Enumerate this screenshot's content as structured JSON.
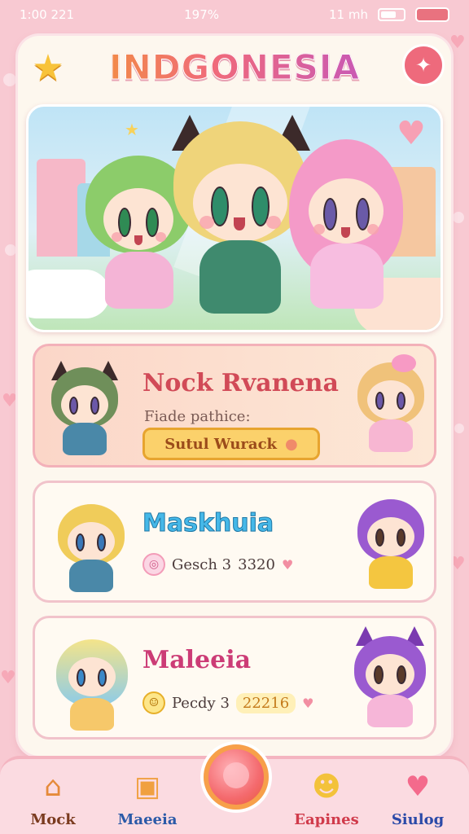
{
  "status_bar": {
    "time": "1:00 221",
    "center": "197%",
    "signal": "11 mh"
  },
  "header": {
    "title": "INDGONESIA",
    "left_icon": "star-icon",
    "right_icon": "candy-icon"
  },
  "hero": {
    "characters": [
      "green-hair-cat-girl",
      "blonde-cat-girl",
      "pink-hair-girl"
    ]
  },
  "cards": [
    {
      "title": "Nock Rvanena",
      "subtitle": "Fiade pathice:",
      "button_label": "Sutul Wurack",
      "button_icon": "bean-icon"
    },
    {
      "title": "Maskhuia",
      "stat_text": "Gesch 3",
      "stat_value": "3320",
      "stat_icon": "coin-icon"
    },
    {
      "title": "Maleeia",
      "stat_text": "Pecdy 3",
      "stat_value": "22216",
      "stat_icon": "smile-coin-icon"
    }
  ],
  "tab_bar": {
    "tabs": [
      {
        "label": "Mock",
        "icon": "house-icon",
        "color": "#7a3b1f"
      },
      {
        "label": "Maeeia",
        "icon": "gift-box-icon",
        "color": "#2b5aa8"
      },
      {
        "label": "",
        "icon": "center-orb-icon",
        "color": "#f46a6e"
      },
      {
        "label": "Eapines",
        "icon": "smiley-badge-icon",
        "color": "#d03a4a"
      },
      {
        "label": "Siulog",
        "icon": "heart-balloon-icon",
        "color": "#2b4aa8"
      }
    ]
  },
  "colors": {
    "background": "#f8c9d2",
    "card": "#fdf7ee",
    "accent_pink": "#ee6a7c",
    "accent_yellow": "#fbd16b"
  }
}
